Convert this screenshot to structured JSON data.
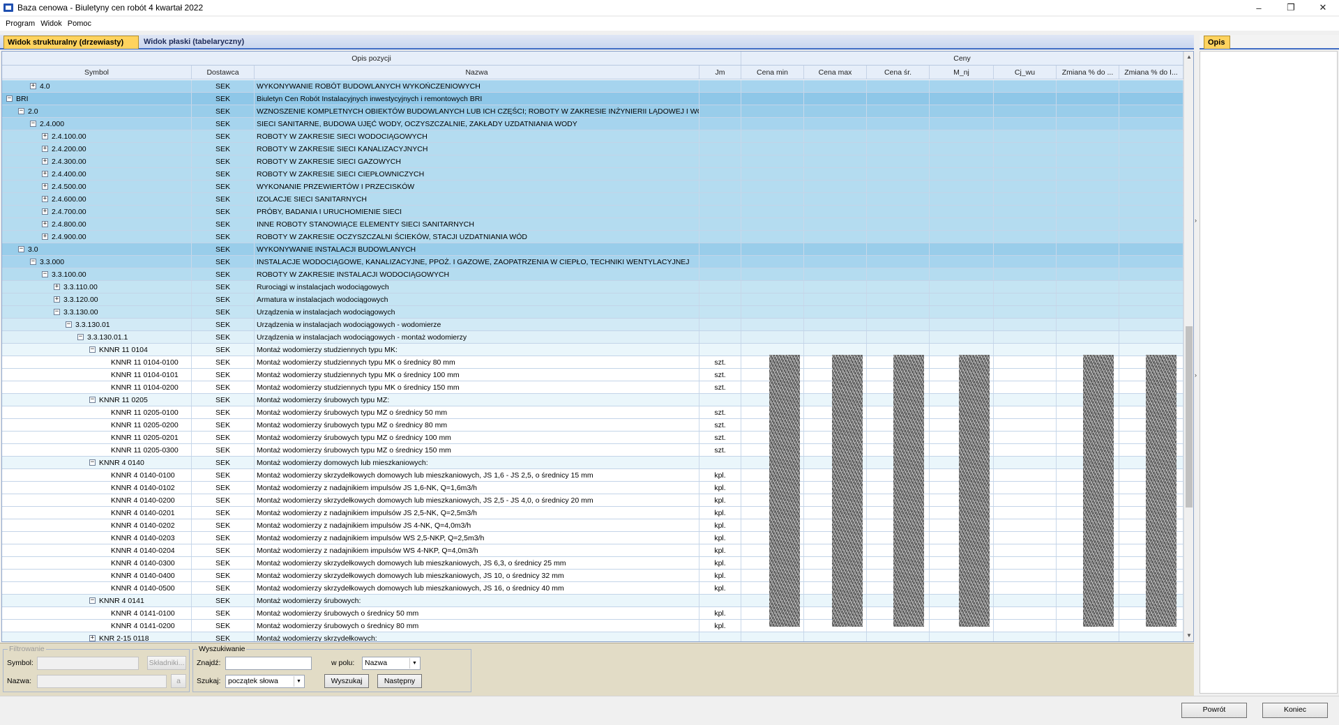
{
  "window": {
    "title": "Baza cenowa - Biuletyny cen robót 4 kwartał 2022",
    "controls": {
      "minimize": "–",
      "restore": "❐",
      "close": "✕"
    }
  },
  "menu": [
    "Program",
    "Widok",
    "Pomoc"
  ],
  "tabs": {
    "structural": "Widok strukturalny (drzewiasty)",
    "flat": "Widok płaski (tabelaryczny)",
    "opis": "Opis"
  },
  "grid": {
    "group_headers": {
      "opis_pozycji": "Opis pozycji",
      "ceny": "Ceny"
    },
    "columns": {
      "symbol": "Symbol",
      "dostawca": "Dostawca",
      "nazwa": "Nazwa",
      "jm": "Jm",
      "cena_min": "Cena min",
      "cena_max": "Cena max",
      "cena_sr": "Cena śr.",
      "m_nj": "M_nj",
      "cj_wu": "Cj_wu",
      "zmiana1": "Zmiana % do ...",
      "zmiana2": "Zmiana % do I..."
    },
    "rows": [
      {
        "symbol": "4.0",
        "dostawca": "SEK",
        "nazwa": "WYKONYWANIE ROBÓT BUDOWLANYCH WYKOŃCZENIOWYCH",
        "jm": "",
        "expander": "+"
      },
      {
        "symbol": "BRI",
        "dostawca": "SEK",
        "nazwa": "Biuletyn Cen Robót Instalacyjnych inwestycyjnych i remontowych BRI",
        "jm": "",
        "expander": "−"
      },
      {
        "symbol": "2.0",
        "dostawca": "SEK",
        "nazwa": "WZNOSZENIE KOMPLETNYCH OBIEKTÓW BUDOWLANYCH LUB ICH CZĘŚCI; ROBOTY W ZAKRESIE INŻYNIERII LĄDOWEJ I WODNEJ",
        "jm": "",
        "expander": "−"
      },
      {
        "symbol": "2.4.000",
        "dostawca": "SEK",
        "nazwa": "SIECI SANITARNE, BUDOWA UJĘĆ WODY, OCZYSZCZALNIE, ZAKŁADY UZDATNIANIA WODY",
        "jm": "",
        "expander": "−"
      },
      {
        "symbol": "2.4.100.00",
        "dostawca": "SEK",
        "nazwa": "ROBOTY W ZAKRESIE SIECI WODOCIĄGOWYCH",
        "jm": "",
        "expander": "+"
      },
      {
        "symbol": "2.4.200.00",
        "dostawca": "SEK",
        "nazwa": "ROBOTY W ZAKRESIE SIECI KANALIZACYJNYCH",
        "jm": "",
        "expander": "+"
      },
      {
        "symbol": "2.4.300.00",
        "dostawca": "SEK",
        "nazwa": "ROBOTY W ZAKRESIE SIECI GAZOWYCH",
        "jm": "",
        "expander": "+"
      },
      {
        "symbol": "2.4.400.00",
        "dostawca": "SEK",
        "nazwa": "ROBOTY W ZAKRESIE SIECI CIEPŁOWNICZYCH",
        "jm": "",
        "expander": "+"
      },
      {
        "symbol": "2.4.500.00",
        "dostawca": "SEK",
        "nazwa": "WYKONANIE PRZEWIERTÓW I PRZECISKÓW",
        "jm": "",
        "expander": "+"
      },
      {
        "symbol": "2.4.600.00",
        "dostawca": "SEK",
        "nazwa": "IZOLACJE SIECI SANITARNYCH",
        "jm": "",
        "expander": "+"
      },
      {
        "symbol": "2.4.700.00",
        "dostawca": "SEK",
        "nazwa": "PRÓBY, BADANIA I URUCHOMIENIE SIECI",
        "jm": "",
        "expander": "+"
      },
      {
        "symbol": "2.4.800.00",
        "dostawca": "SEK",
        "nazwa": "INNE ROBOTY STANOWIĄCE ELEMENTY SIECI SANITARNYCH",
        "jm": "",
        "expander": "+"
      },
      {
        "symbol": "2.4.900.00",
        "dostawca": "SEK",
        "nazwa": "ROBOTY W ZAKRESIE OCZYSZCZALNI ŚCIEKÓW, STACJI UZDATNIANIA WÓD",
        "jm": "",
        "expander": "+"
      },
      {
        "symbol": "3.0",
        "dostawca": "SEK",
        "nazwa": "WYKONYWANIE INSTALACJI BUDOWLANYCH",
        "jm": "",
        "expander": "−"
      },
      {
        "symbol": "3.3.000",
        "dostawca": "SEK",
        "nazwa": "INSTALACJE WODOCIĄGOWE, KANALIZACYJNE, PPOŻ. I GAZOWE, ZAOPATRZENIA W CIEPŁO, TECHNIKI WENTYLACYJNEJ",
        "jm": "",
        "expander": "−"
      },
      {
        "symbol": "3.3.100.00",
        "dostawca": "SEK",
        "nazwa": "ROBOTY W ZAKRESIE INSTALACJI WODOCIĄGOWYCH",
        "jm": "",
        "expander": "−"
      },
      {
        "symbol": "3.3.110.00",
        "dostawca": "SEK",
        "nazwa": "Rurociągi w instalacjach wodociągowych",
        "jm": "",
        "expander": "+"
      },
      {
        "symbol": "3.3.120.00",
        "dostawca": "SEK",
        "nazwa": "Armatura w instalacjach wodociągowych",
        "jm": "",
        "expander": "+"
      },
      {
        "symbol": "3.3.130.00",
        "dostawca": "SEK",
        "nazwa": "Urządzenia w instalacjach wodociągowych",
        "jm": "",
        "expander": "−"
      },
      {
        "symbol": "3.3.130.01",
        "dostawca": "SEK",
        "nazwa": "Urządzenia w instalacjach wodociągowych - wodomierze",
        "jm": "",
        "expander": "−"
      },
      {
        "symbol": "3.3.130.01.1",
        "dostawca": "SEK",
        "nazwa": "Urządzenia w instalacjach wodociągowych - montaż wodomierzy",
        "jm": "",
        "expander": "−"
      },
      {
        "symbol": "KNNR 11 0104",
        "dostawca": "SEK",
        "nazwa": "Montaż wodomierzy studziennych typu MK:",
        "jm": "",
        "expander": "−"
      },
      {
        "symbol": "KNNR 11 0104-0100",
        "dostawca": "SEK",
        "nazwa": "Montaż wodomierzy studziennych typu MK o średnicy 80 mm",
        "jm": "szt.",
        "expander": ""
      },
      {
        "symbol": "KNNR 11 0104-0101",
        "dostawca": "SEK",
        "nazwa": "Montaż wodomierzy studziennych typu MK o średnicy 100 mm",
        "jm": "szt.",
        "expander": ""
      },
      {
        "symbol": "KNNR 11 0104-0200",
        "dostawca": "SEK",
        "nazwa": "Montaż wodomierzy studziennych typu MK o średnicy 150 mm",
        "jm": "szt.",
        "expander": ""
      },
      {
        "symbol": "KNNR 11 0205",
        "dostawca": "SEK",
        "nazwa": "Montaż wodomierzy śrubowych typu MZ:",
        "jm": "",
        "expander": "−"
      },
      {
        "symbol": "KNNR 11 0205-0100",
        "dostawca": "SEK",
        "nazwa": "Montaż wodomierzy śrubowych typu MZ o średnicy 50 mm",
        "jm": "szt.",
        "expander": ""
      },
      {
        "symbol": "KNNR 11 0205-0200",
        "dostawca": "SEK",
        "nazwa": "Montaż wodomierzy śrubowych typu MZ o średnicy 80 mm",
        "jm": "szt.",
        "expander": ""
      },
      {
        "symbol": "KNNR 11 0205-0201",
        "dostawca": "SEK",
        "nazwa": "Montaż wodomierzy śrubowych typu MZ o średnicy 100 mm",
        "jm": "szt.",
        "expander": ""
      },
      {
        "symbol": "KNNR 11 0205-0300",
        "dostawca": "SEK",
        "nazwa": "Montaż wodomierzy śrubowych typu MZ o średnicy 150 mm",
        "jm": "szt.",
        "expander": ""
      },
      {
        "symbol": "KNNR 4 0140",
        "dostawca": "SEK",
        "nazwa": "Montaż wodomierzy domowych lub mieszkaniowych:",
        "jm": "",
        "expander": "−"
      },
      {
        "symbol": "KNNR 4 0140-0100",
        "dostawca": "SEK",
        "nazwa": "Montaż wodomierzy skrzydełkowych domowych lub mieszkaniowych, JS 1,6 - JS 2,5, o średnicy 15 mm",
        "jm": "kpl.",
        "expander": ""
      },
      {
        "symbol": "KNNR 4 0140-0102",
        "dostawca": "SEK",
        "nazwa": "Montaż wodomierzy z nadajnikiem impulsów JS 1,6-NK, Q=1,6m3/h",
        "jm": "kpl.",
        "expander": ""
      },
      {
        "symbol": "KNNR 4 0140-0200",
        "dostawca": "SEK",
        "nazwa": "Montaż wodomierzy skrzydełkowych domowych lub mieszkaniowych, JS 2,5 - JS 4,0, o średnicy 20 mm",
        "jm": "kpl.",
        "expander": ""
      },
      {
        "symbol": "KNNR 4 0140-0201",
        "dostawca": "SEK",
        "nazwa": "Montaż wodomierzy z nadajnikiem impulsów JS 2,5-NK, Q=2,5m3/h",
        "jm": "kpl.",
        "expander": ""
      },
      {
        "symbol": "KNNR 4 0140-0202",
        "dostawca": "SEK",
        "nazwa": "Montaż wodomierzy z nadajnikiem impulsów JS 4-NK, Q=4,0m3/h",
        "jm": "kpl.",
        "expander": ""
      },
      {
        "symbol": "KNNR 4 0140-0203",
        "dostawca": "SEK",
        "nazwa": "Montaż wodomierzy z nadajnikiem impulsów WS 2,5-NKP, Q=2,5m3/h",
        "jm": "kpl.",
        "expander": ""
      },
      {
        "symbol": "KNNR 4 0140-0204",
        "dostawca": "SEK",
        "nazwa": "Montaż wodomierzy z nadajnikiem impulsów WS 4-NKP, Q=4,0m3/h",
        "jm": "kpl.",
        "expander": ""
      },
      {
        "symbol": "KNNR 4 0140-0300",
        "dostawca": "SEK",
        "nazwa": "Montaż wodomierzy skrzydełkowych domowych lub mieszkaniowych, JS 6,3, o średnicy 25 mm",
        "jm": "kpl.",
        "expander": ""
      },
      {
        "symbol": "KNNR 4 0140-0400",
        "dostawca": "SEK",
        "nazwa": "Montaż wodomierzy skrzydełkowych domowych lub mieszkaniowych, JS 10, o średnicy 32 mm",
        "jm": "kpl.",
        "expander": ""
      },
      {
        "symbol": "KNNR 4 0140-0500",
        "dostawca": "SEK",
        "nazwa": "Montaż wodomierzy skrzydełkowych domowych lub mieszkaniowych, JS 16, o średnicy 40 mm",
        "jm": "kpl.",
        "expander": ""
      },
      {
        "symbol": "KNNR 4 0141",
        "dostawca": "SEK",
        "nazwa": "Montaż wodomierzy śrubowych:",
        "jm": "",
        "expander": "−"
      },
      {
        "symbol": "KNNR 4 0141-0100",
        "dostawca": "SEK",
        "nazwa": "Montaż wodomierzy śrubowych o średnicy 50 mm",
        "jm": "kpl.",
        "expander": ""
      },
      {
        "symbol": "KNNR 4 0141-0200",
        "dostawca": "SEK",
        "nazwa": "Montaż wodomierzy śrubowych o średnicy 80 mm",
        "jm": "kpl.",
        "expander": ""
      },
      {
        "symbol": "KNR 2-15 0118",
        "dostawca": "SEK",
        "nazwa": "Montaż wodomierzy skrzydełkowych:",
        "jm": "",
        "expander": "+"
      }
    ]
  },
  "filter": {
    "legend": "Filtrowanie",
    "symbol_label": "Symbol:",
    "nazwa_label": "Nazwa:",
    "skladniki_button": "Składniki...",
    "clear_button": "a"
  },
  "search": {
    "legend": "Wyszukiwanie",
    "znajdz_label": "Znajdź:",
    "znajdz_value": "",
    "w_polu_label": "w polu:",
    "w_polu_value": "Nazwa",
    "szukaj_label": "Szukaj:",
    "szukaj_value": "początek słowa",
    "wyszukaj_button": "Wyszukaj",
    "nastepny_button": "Następny"
  },
  "footer": {
    "powrot_button": "Powrót",
    "koniec_button": "Koniec"
  },
  "colors": {
    "active_tab": "#ffd35e",
    "tab_border": "#3f6cc4",
    "bottom_panel": "#e2dcc6"
  }
}
